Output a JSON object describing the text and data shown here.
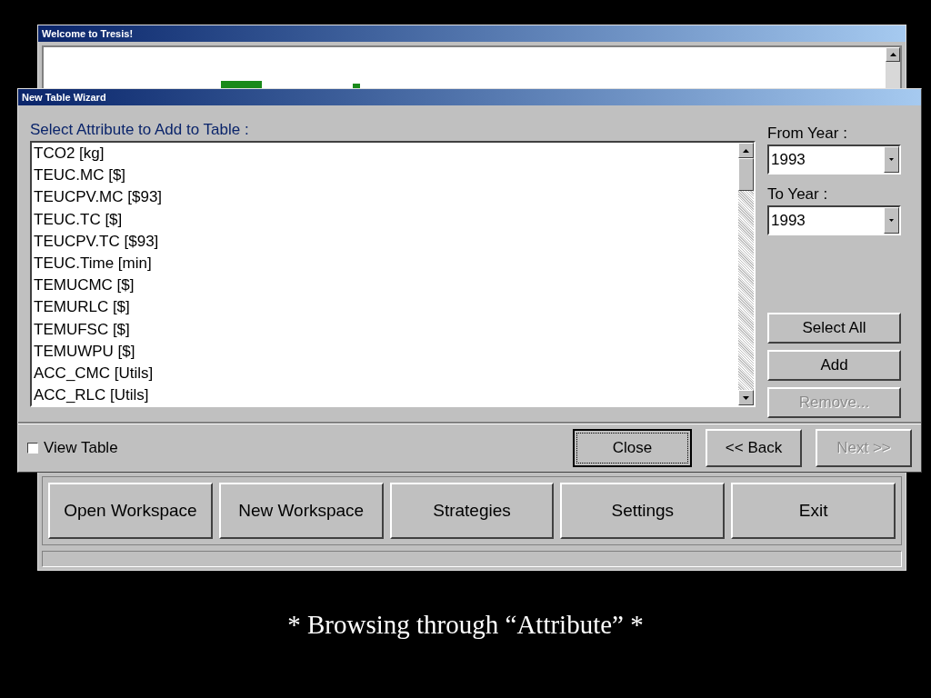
{
  "main_window": {
    "title": "Welcome to Tresis!",
    "buttons": [
      {
        "label": "Open Workspace"
      },
      {
        "label": "New Workspace"
      },
      {
        "label": "Strategies"
      },
      {
        "label": "Settings"
      },
      {
        "label": "Exit"
      }
    ]
  },
  "dialog": {
    "title": "New Table Wizard",
    "list_label": "Select Attribute to Add to Table :",
    "attributes": [
      "TCO2 [kg]",
      "TEUC.MC [$]",
      "TEUCPV.MC [$93]",
      "TEUC.TC [$]",
      "TEUCPV.TC [$93]",
      "TEUC.Time [min]",
      "TEMUCMC [$]",
      "TEMURLC [$]",
      "TEMUFSC [$]",
      "TEMUWPU [$]",
      "ACC_CMC [Utils]",
      "ACC_RLC [Utils]"
    ],
    "from_year": {
      "label": "From Year :",
      "value": "1993"
    },
    "to_year": {
      "label": "To Year :",
      "value": "1993"
    },
    "side_buttons": [
      {
        "label": "Select All",
        "disabled": false
      },
      {
        "label": "Add",
        "disabled": false
      },
      {
        "label": "Remove...",
        "disabled": true
      }
    ],
    "view_table": {
      "label": "View Table",
      "checked": false
    },
    "footer_buttons": [
      {
        "label": "Close",
        "disabled": false
      },
      {
        "label": "<< Back",
        "disabled": false
      },
      {
        "label": "Next >>",
        "disabled": true
      }
    ]
  },
  "caption": "* Browsing through “Attribute” *"
}
